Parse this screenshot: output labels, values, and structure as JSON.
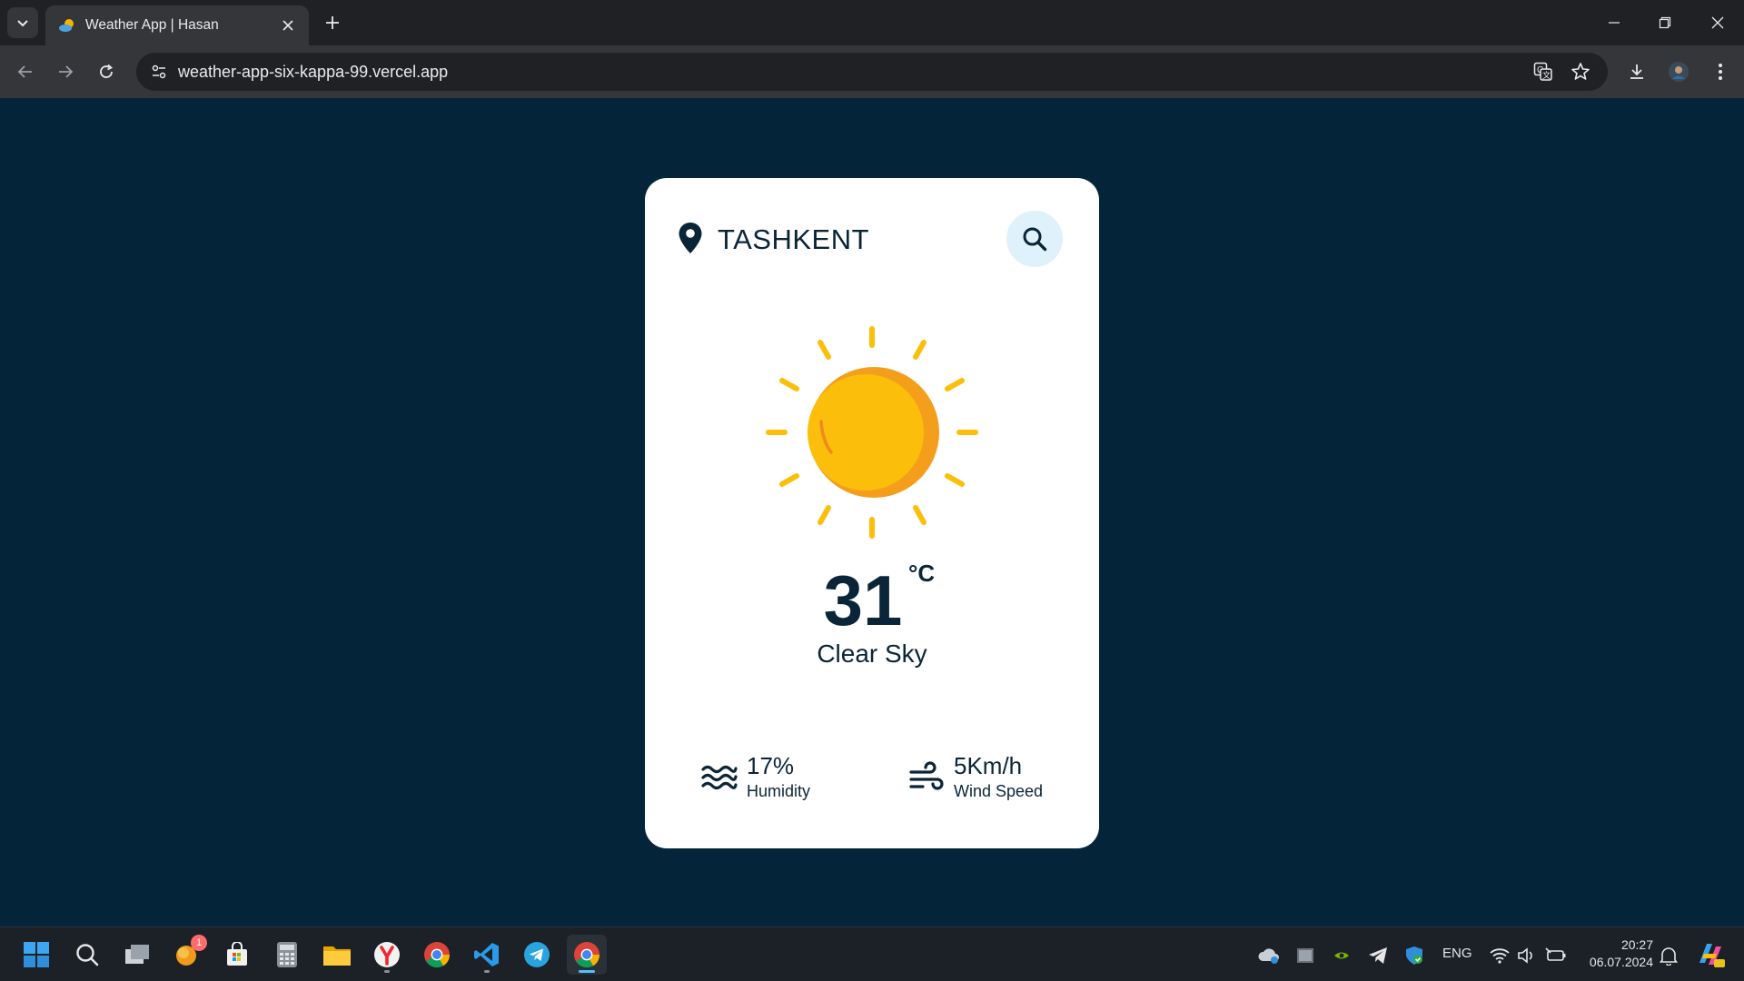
{
  "browser": {
    "tab_title": "Weather App | Hasan",
    "url": "weather-app-six-kappa-99.vercel.app"
  },
  "weather": {
    "city": "TASHKENT",
    "temperature": "31",
    "unit": "°C",
    "condition": "Clear Sky",
    "humidity_value": "17%",
    "humidity_label": "Humidity",
    "wind_value": "5Km/h",
    "wind_label": "Wind Speed",
    "icon": "sun-icon"
  },
  "colors": {
    "page_background": "#042539",
    "card_background": "#ffffff",
    "text": "#0a2537",
    "search_button_bg": "#dff1fb",
    "sun": "#fbbf0b",
    "sun_shade": "#f59e1c"
  },
  "taskbar": {
    "notification_badge": "1",
    "language": "ENG",
    "time": "20:27",
    "date": "06.07.2024"
  }
}
